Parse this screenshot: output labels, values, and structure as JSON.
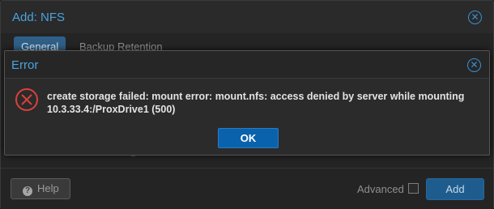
{
  "window": {
    "title": "Add: NFS",
    "tabs": [
      {
        "label": "General",
        "active": true
      },
      {
        "label": "Backup Retention",
        "active": false
      }
    ],
    "ghost_text": "g",
    "footer": {
      "help_label": "Help",
      "advanced_label": "Advanced",
      "advanced_checked": false,
      "add_label": "Add"
    }
  },
  "error_dialog": {
    "title": "Error",
    "message_line1": "create storage failed: mount error: mount.nfs: access denied by server while mounting",
    "message_line2": "10.3.33.4:/ProxDrive1 (500)",
    "ok_label": "OK"
  },
  "icons": {
    "close": "close-icon",
    "error": "error-icon",
    "help": "question-circle-icon"
  },
  "colors": {
    "accent": "#4aa3df",
    "primary_button": "#0a62ad",
    "error_icon": "#d9413b"
  }
}
